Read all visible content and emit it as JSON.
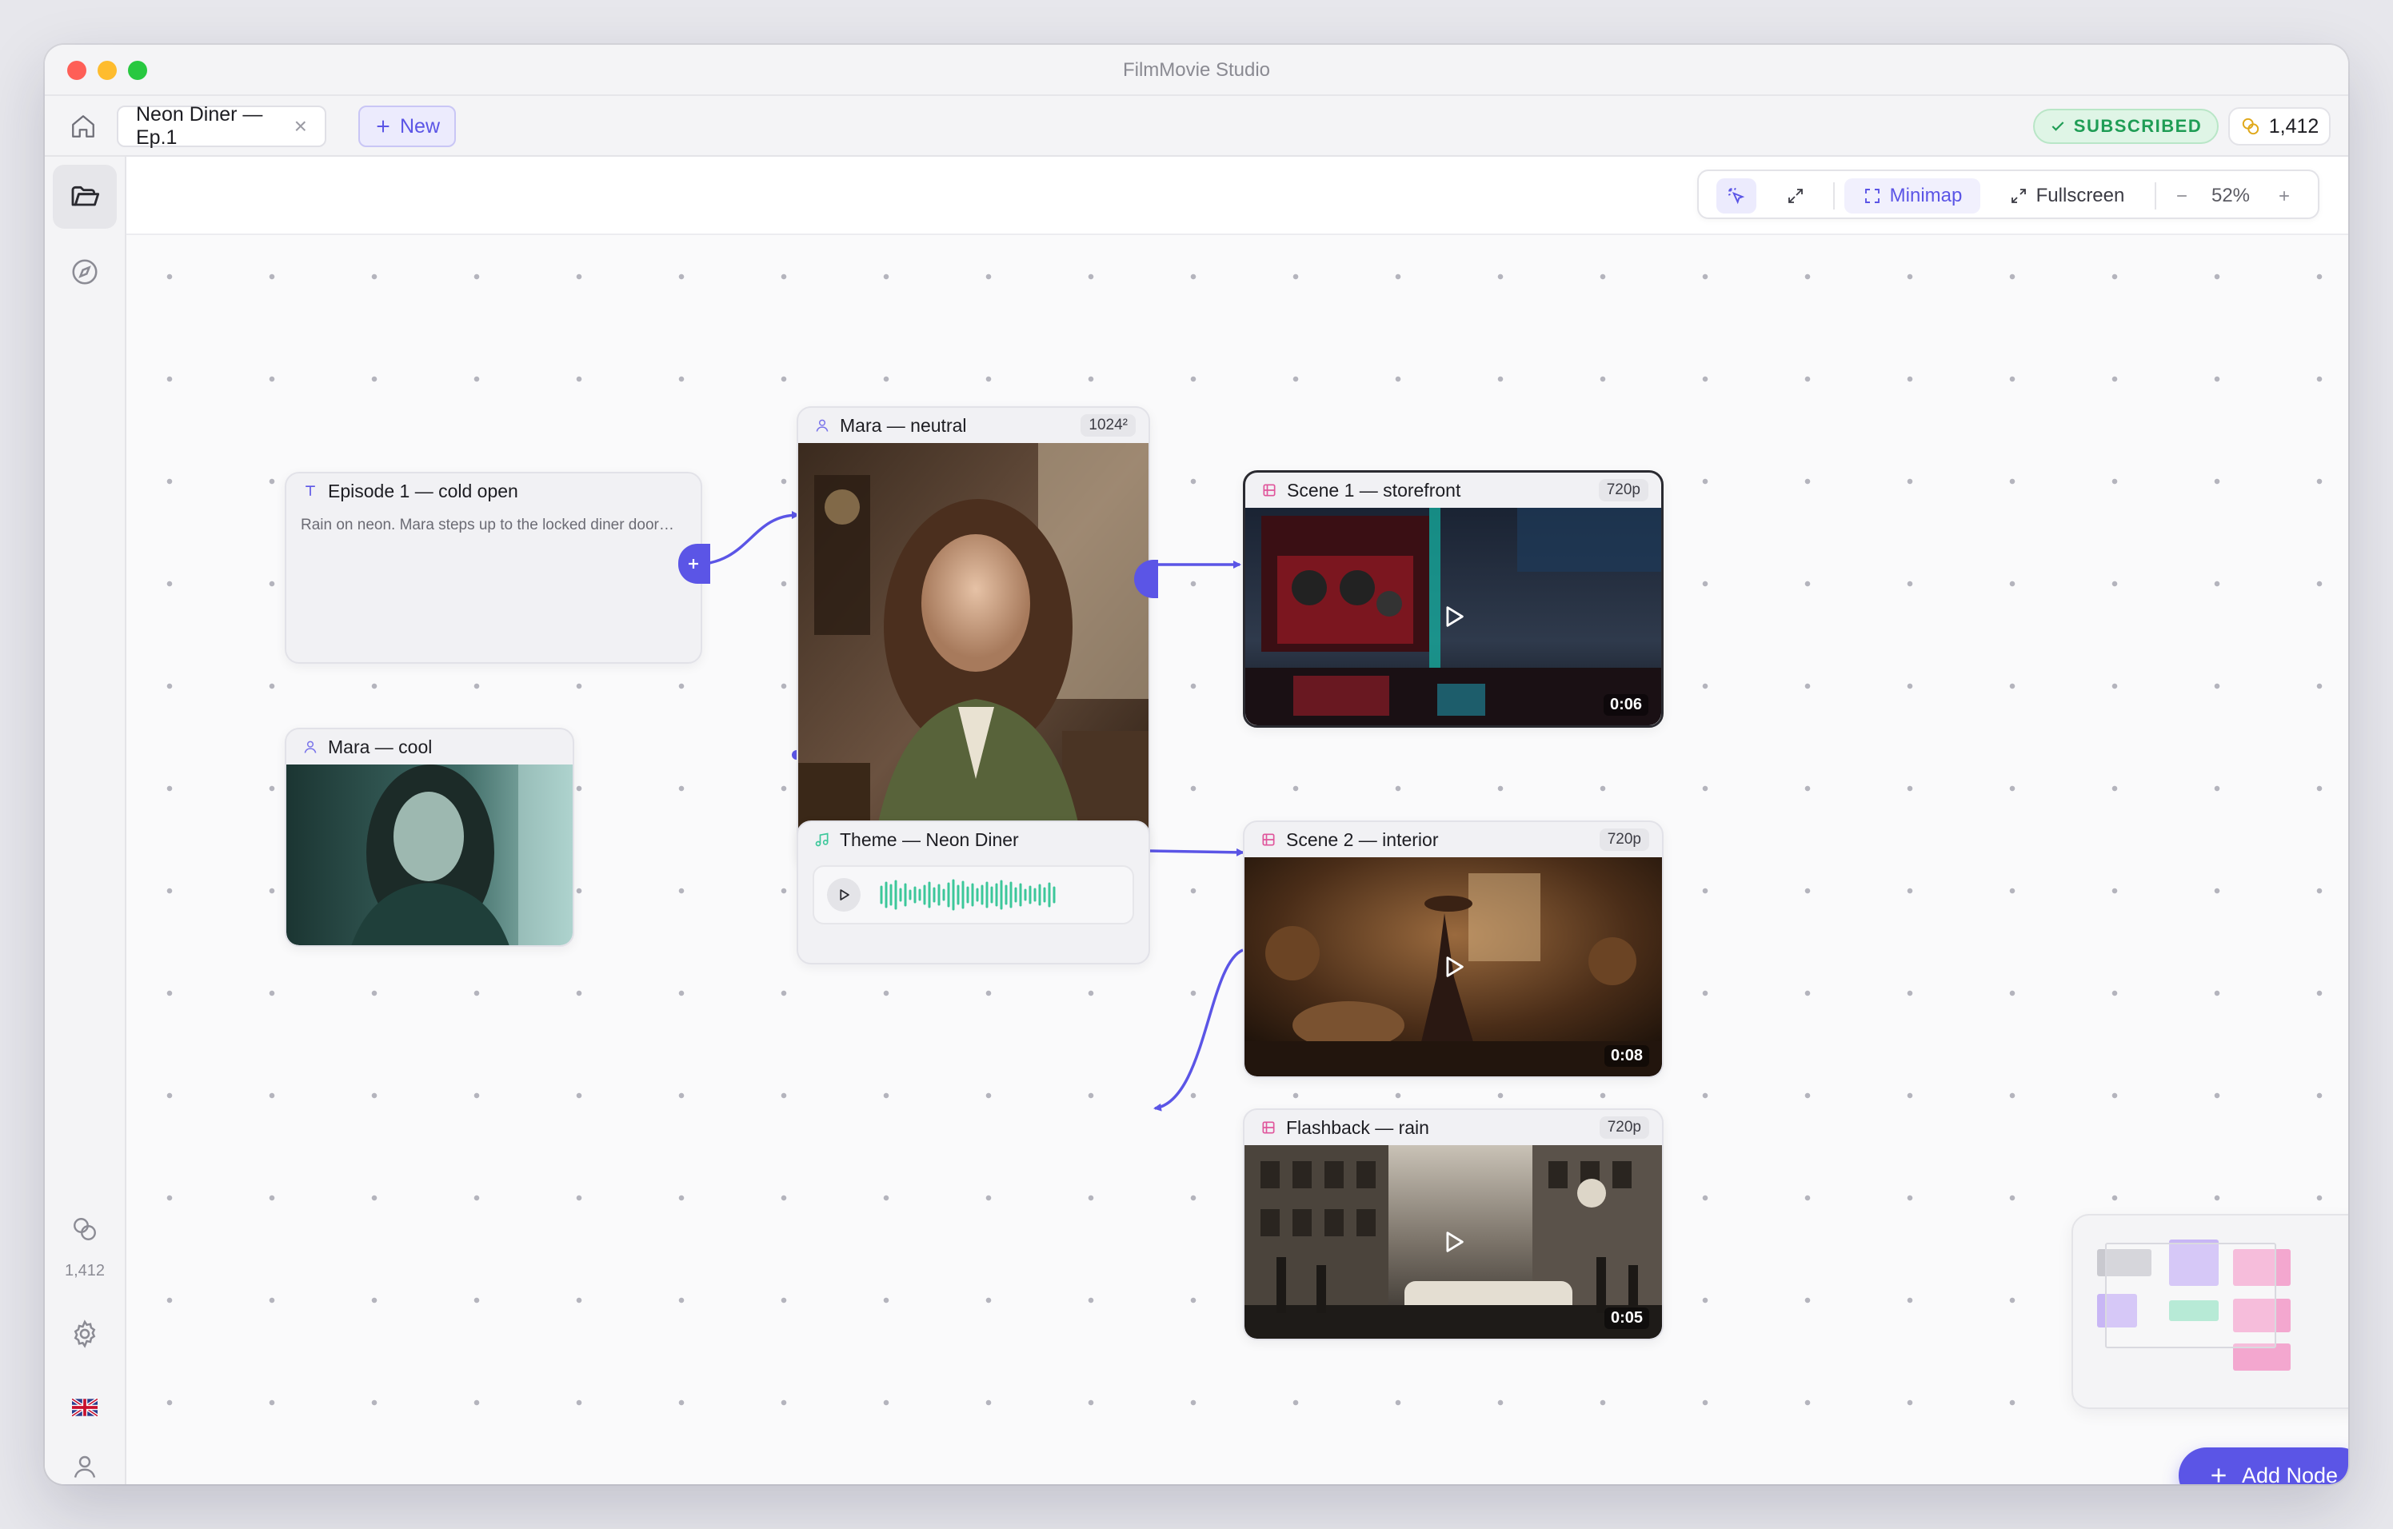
{
  "window": {
    "title": "FilmMovie Studio"
  },
  "tabs": [
    {
      "label": "Neon Diner — Ep.1"
    }
  ],
  "new_tab_label": "New",
  "header": {
    "subscription_badge": "SUBSCRIBED",
    "credits": "1,412"
  },
  "sidebar": {
    "credits": "1,412"
  },
  "toolbar": {
    "minimap_label": "Minimap",
    "fullscreen_label": "Fullscreen",
    "zoom": "52%"
  },
  "nodes": {
    "episode": {
      "title": "Episode 1 — cold open",
      "body": "Rain on neon. Mara steps up to the locked diner door…"
    },
    "mara_neutral": {
      "title": "Mara — neutral",
      "resolution": "1024²"
    },
    "mara_cool": {
      "title": "Mara — cool"
    },
    "theme": {
      "title": "Theme — Neon Diner"
    },
    "scene1": {
      "title": "Scene 1 — storefront",
      "resolution": "720p",
      "duration": "0:06"
    },
    "scene2": {
      "title": "Scene 2 — interior",
      "resolution": "720p",
      "duration": "0:08"
    },
    "flashback": {
      "title": "Flashback — rain",
      "resolution": "720p",
      "duration": "0:05"
    }
  },
  "add_node_label": "Add Node",
  "colors": {
    "accent": "#5b55e6",
    "audio_wave": "#3cc79a",
    "video_tag": "#e0559b",
    "success": "#1f9d55"
  }
}
